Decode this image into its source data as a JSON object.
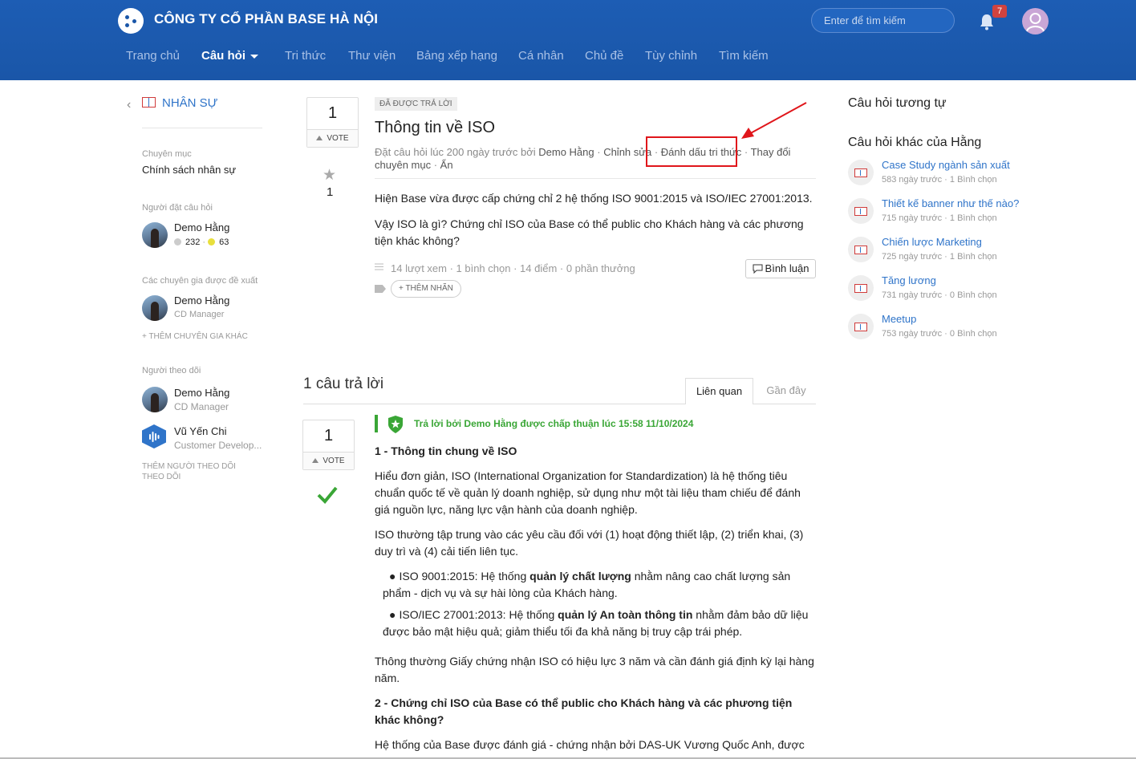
{
  "header": {
    "company": "CÔNG TY CỔ PHẦN BASE HÀ NỘI",
    "search_placeholder": "Enter để tìm kiếm",
    "notification_count": "7",
    "nav": [
      "Trang chủ",
      "Câu hỏi",
      "Tri thức",
      "Thư viện",
      "Bảng xếp hạng",
      "Cá nhân",
      "Chủ đề",
      "Tùy chỉnh",
      "Tìm kiếm"
    ]
  },
  "sidebar": {
    "department": "NHÂN SỰ",
    "category_label": "Chuyên mục",
    "category_value": "Chính sách nhân sự",
    "asker_label": "Người đặt câu hỏi",
    "asker_name": "Demo Hằng",
    "asker_points": "232",
    "asker_badges": "63",
    "experts_label": "Các chuyên gia được đề xuất",
    "expert_name": "Demo Hằng",
    "expert_role": "CD Manager",
    "add_expert": "+ THÊM CHUYÊN GIA KHÁC",
    "followers_label": "Người theo dõi",
    "followers": [
      {
        "name": "Demo Hằng",
        "role": "CD Manager"
      },
      {
        "name": "Vũ Yến Chi",
        "role": "Customer Develop..."
      }
    ],
    "add_follower_1": "THÊM NGƯỜI THEO DÕI",
    "add_follower_2": "THEO DÕI"
  },
  "question": {
    "vote_count": "1",
    "vote_label": "VOTE",
    "star_count": "1",
    "status_tag": "ĐÃ ĐƯỢC TRẢ LỜI",
    "title": "Thông tin về ISO",
    "meta_prefix": "Đặt câu hỏi lúc 200 ngày trước bởi ",
    "meta_author": "Demo Hằng",
    "meta_edit": "Chỉnh sửa",
    "meta_mark": "Đánh dấu tri thức",
    "meta_move": "Thay đổi chuyên mục",
    "meta_hide": "Ẩn",
    "body_1": "Hiện Base vừa được cấp chứng chỉ 2 hệ thống ISO 9001:2015 và ISO/IEC 27001:2013.",
    "body_2": "Vậy ISO là gì? Chứng chỉ ISO của Base có thể public cho Khách hàng và các phương tiện khác không?",
    "stats": "14 lượt xem · 1 bình chọn · 14 điểm · 0 phần thưởng",
    "comment_label": "Bình luận",
    "add_tag": "+ THÊM NHÃN"
  },
  "answers": {
    "count_label": "1 câu trả lời",
    "tab_related": "Liên quan",
    "tab_recent": "Gần đây",
    "vote_count": "1",
    "vote_label": "VOTE",
    "accepted_text": "Trả lời bởi Demo Hằng được chấp thuận lúc 15:58 11/10/2024",
    "heading_1": "1 - Thông tin chung về ISO",
    "para_1": "Hiểu đơn giản, ISO (International Organization for Standardization) là hệ thống tiêu chuẩn quốc tế về quản lý doanh nghiệp, sử dụng như một tài liệu tham chiếu để đánh giá nguồn lực, năng lực vận hành của doanh nghiệp.",
    "para_2": "ISO thường tập trung vào các yêu cầu đối với (1) hoạt động thiết lập, (2) triển khai, (3) duy trì và (4) cải tiến liên tục.",
    "bullet_1_pre": "ISO 9001:2015: Hệ thống ",
    "bullet_1_bold": "quản lý chất lượng",
    "bullet_1_post": " nhằm nâng cao chất lượng sản phẩm - dịch vụ và sự hài lòng của Khách hàng.",
    "bullet_2_pre": "ISO/IEC 27001:2013: Hệ thống ",
    "bullet_2_bold": "quản lý An toàn thông tin",
    "bullet_2_post": " nhằm đảm bảo dữ liệu được bảo mật hiệu quả; giảm thiểu tối đa khả năng bị truy cập trái phép.",
    "para_3": "Thông thường Giấy chứng nhận ISO có hiệu lực 3 năm và cần đánh giá định kỳ lại hàng năm.",
    "heading_2": "2 - Chứng chỉ ISO của Base có thể public cho Khách hàng và các phương tiện khác không?",
    "para_4": "Hệ thống của Base được đánh giá - chứng nhận bởi DAS-UK Vương Quốc Anh, được"
  },
  "right": {
    "similar_title": "Câu hỏi tương tự",
    "other_title": "Câu hỏi khác của Hằng",
    "items": [
      {
        "title": "Case Study ngành sản xuất",
        "meta": "583 ngày trước · 1 Bình chọn"
      },
      {
        "title": "Thiết kế banner như thế nào?",
        "meta": "715 ngày trước · 1 Bình chọn"
      },
      {
        "title": "Chiến lược Marketing",
        "meta": "725 ngày trước · 1 Bình chọn"
      },
      {
        "title": "Tăng lương",
        "meta": "731 ngày trước · 0 Bình chọn"
      },
      {
        "title": "Meetup",
        "meta": "753 ngày trước · 0 Bình chọn"
      }
    ]
  },
  "colors": {
    "header": "#1a56a8",
    "link": "#2f74c9",
    "accepted": "#3aa636",
    "highlight": "#e0161b"
  }
}
